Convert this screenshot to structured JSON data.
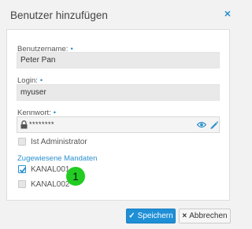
{
  "dialog": {
    "title": "Benutzer hinzufügen",
    "close_icon": "×"
  },
  "form": {
    "username": {
      "label": "Benutzername:",
      "required": "•",
      "value": "Peter Pan"
    },
    "login": {
      "label": "Login:",
      "required": "•",
      "value": "myuser"
    },
    "password": {
      "label": "Kennwort:",
      "required": "•",
      "value": "********"
    },
    "is_admin": {
      "label": "Ist Administrator",
      "checked": false
    }
  },
  "mandates": {
    "title": "Zugewiesene Mandaten",
    "items": [
      {
        "label": "KANAL001",
        "checked": true
      },
      {
        "label": "KANAL002",
        "checked": false
      }
    ]
  },
  "annotation": {
    "badge": "1"
  },
  "footer": {
    "save_icon": "✓",
    "save_label": "Speichern",
    "cancel_icon": "×",
    "cancel_label": "Abbrechen"
  },
  "colors": {
    "accent": "#2a8fd0",
    "primary_button": "#1f8fd6",
    "badge": "#22cc22"
  }
}
